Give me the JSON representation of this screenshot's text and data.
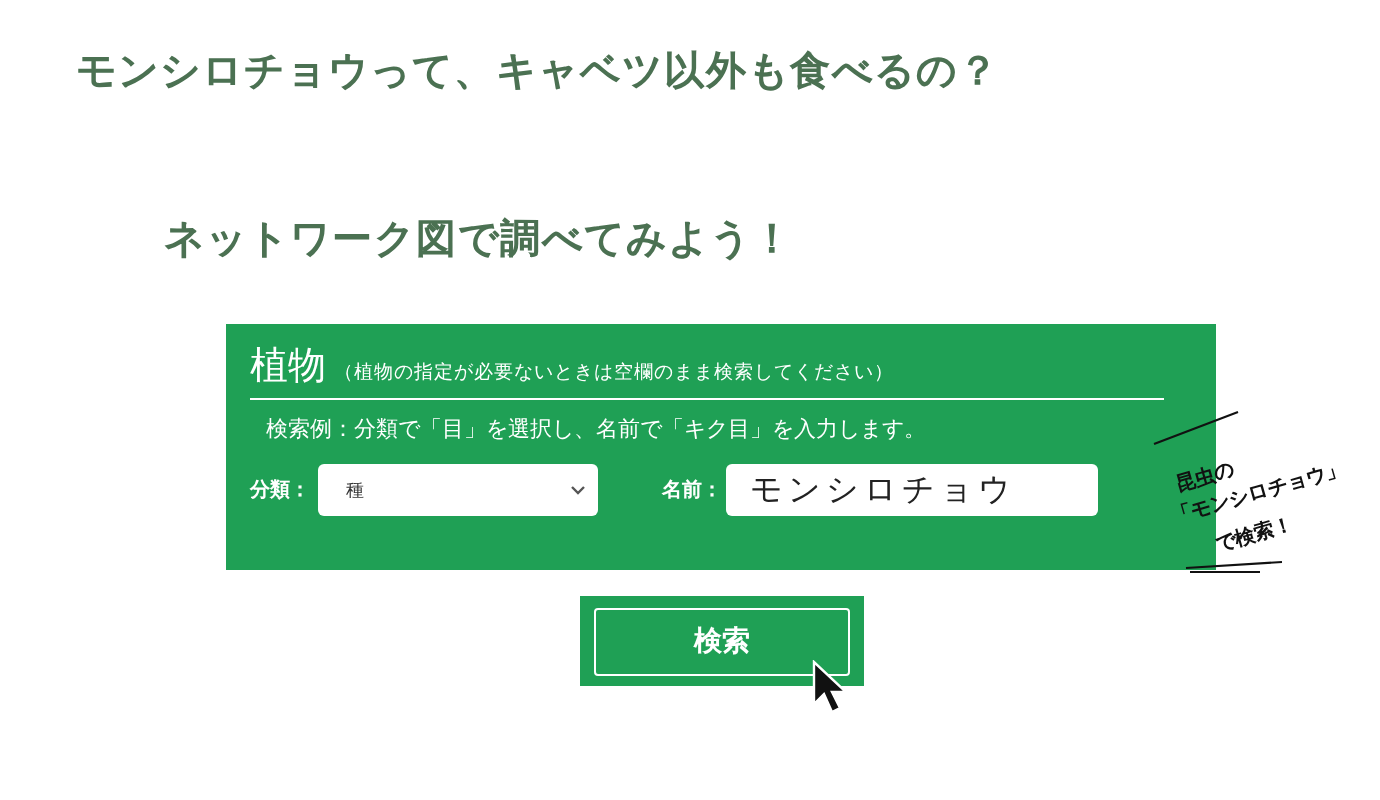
{
  "heading": "モンシロチョウって、キャベツ以外も食べるの？",
  "subheading": "ネットワーク図で調べてみよう！",
  "panel": {
    "title": "植物",
    "note": "（植物の指定が必要ないときは空欄のまま検索してください）",
    "example": "検索例：分類で「目」を選択し、名前で「キク目」を入力します。",
    "category_label": "分類：",
    "category_value": "種",
    "name_label": "名前：",
    "name_value": "モンシロチョウ"
  },
  "annotation": {
    "lines": [
      "昆虫の",
      "「モンシロチョウ」",
      "で検索！"
    ]
  },
  "search_button": "検索"
}
